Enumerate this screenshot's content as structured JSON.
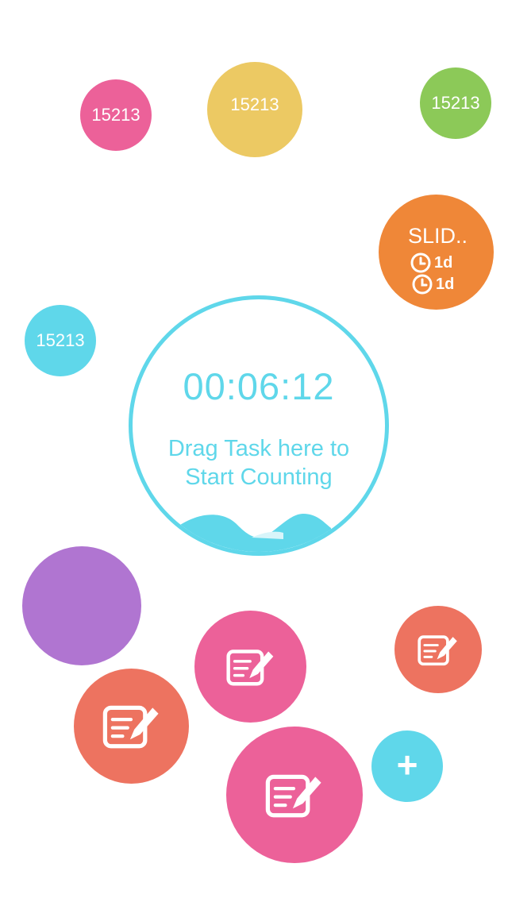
{
  "colors": {
    "pink": "#ec6199",
    "yellow": "#ecc963",
    "green": "#8cc958",
    "orange": "#ef8738",
    "cyan": "#5fd7ea",
    "purple": "#b075d1",
    "salmon": "#ed7360"
  },
  "top_bubbles": [
    {
      "label": "15213",
      "color": "pink"
    },
    {
      "label": "15213",
      "color": "yellow"
    },
    {
      "label": "15213",
      "color": "green"
    },
    {
      "label": "15213",
      "color": "cyan"
    }
  ],
  "task_bubble": {
    "title": "SLID..",
    "rows": [
      {
        "icon": "clock-icon",
        "value": "1d"
      },
      {
        "icon": "clock-icon",
        "value": "1d"
      }
    ]
  },
  "timer": {
    "time": "00:06:12",
    "hint_line1": "Drag Task here to",
    "hint_line2": "Start  Counting"
  },
  "add_button": {
    "label": "+"
  },
  "edit_bubbles": [
    {
      "icon": "edit-note-icon",
      "color": "pink"
    },
    {
      "icon": "edit-note-icon",
      "color": "salmon"
    },
    {
      "icon": "edit-note-icon",
      "color": "salmon"
    },
    {
      "icon": "edit-note-icon",
      "color": "pink"
    }
  ]
}
